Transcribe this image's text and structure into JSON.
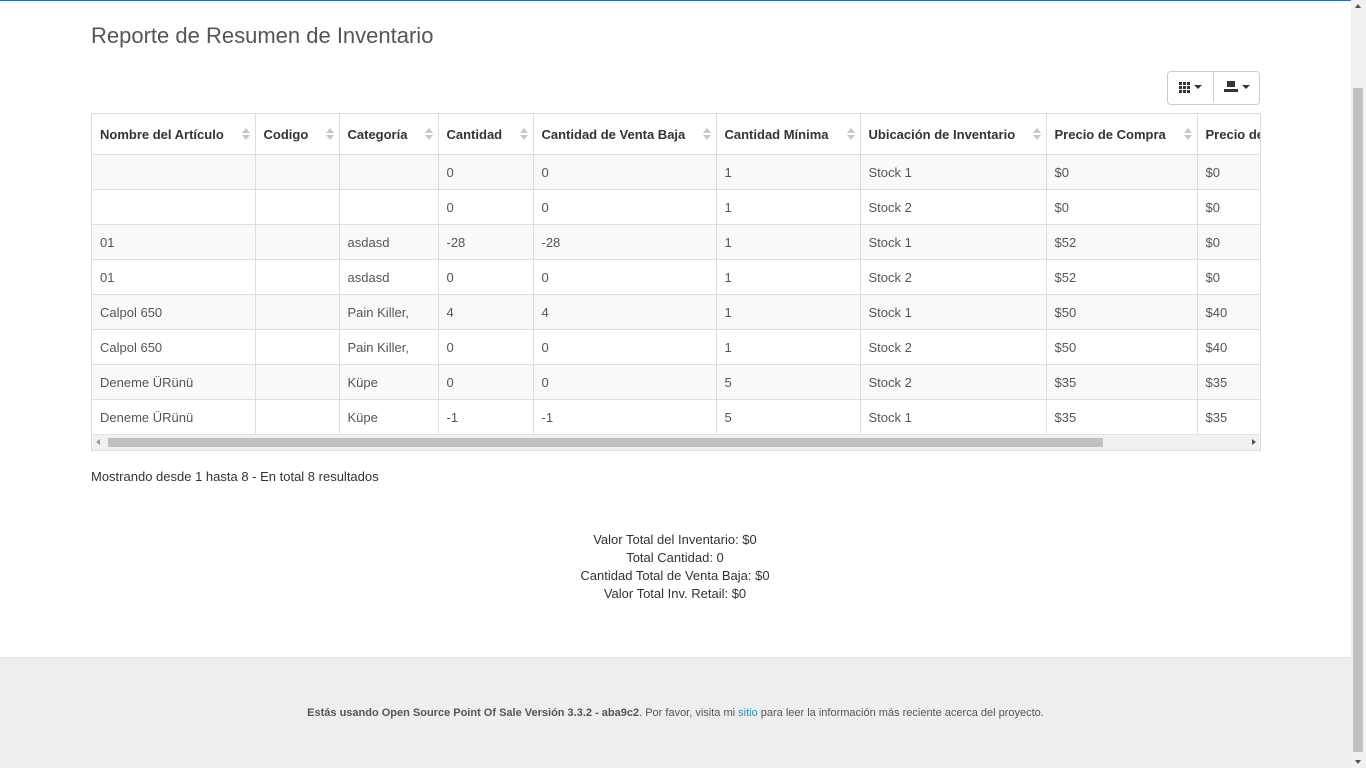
{
  "report": {
    "title": "Reporte de Resumen de Inventario"
  },
  "toolbar": {
    "columns_icon": "columns-grid-icon",
    "export_icon": "export-icon"
  },
  "table": {
    "headers": [
      "Nombre del Artículo",
      "Codigo",
      "Categoría",
      "Cantidad",
      "Cantidad de Venta Baja",
      "Cantidad Mínima",
      "Ubicación de Inventario",
      "Precio de Compra",
      "Precio de"
    ],
    "rows": [
      [
        "",
        "",
        "",
        "0",
        "0",
        "1",
        "Stock 1",
        "$0",
        "$0"
      ],
      [
        "",
        "",
        "",
        "0",
        "0",
        "1",
        "Stock 2",
        "$0",
        "$0"
      ],
      [
        "01",
        "",
        "asdasd",
        "-28",
        "-28",
        "1",
        "Stock 1",
        "$52",
        "$0"
      ],
      [
        "01",
        "",
        "asdasd",
        "0",
        "0",
        "1",
        "Stock 2",
        "$52",
        "$0"
      ],
      [
        "Calpol 650",
        "",
        "Pain Killer,",
        "4",
        "4",
        "1",
        "Stock 1",
        "$50",
        "$40"
      ],
      [
        "Calpol 650",
        "",
        "Pain Killer,",
        "0",
        "0",
        "1",
        "Stock 2",
        "$50",
        "$40"
      ],
      [
        "Deneme ÜRünü",
        "",
        "Küpe",
        "0",
        "0",
        "5",
        "Stock 2",
        "$35",
        "$35"
      ],
      [
        "Deneme ÜRünü",
        "",
        "Küpe",
        "-1",
        "-1",
        "5",
        "Stock 1",
        "$35",
        "$35"
      ]
    ]
  },
  "pagination": {
    "info": "Mostrando desde 1 hasta 8 - En total 8 resultados"
  },
  "summary": {
    "total_inventory_value": "Valor Total del Inventario: $0",
    "total_quantity": "Total Cantidad: 0",
    "total_low_sell_quantity": "Cantidad Total de Venta Baja: $0",
    "total_retail_value": "Valor Total Inv. Retail: $0"
  },
  "footer": {
    "version_text": "Estás usando Open Source Point Of Sale Versión 3.3.2 - aba9c2",
    "before_link": ". Por favor, visita mi ",
    "link_text": "sitio",
    "after_link": " para leer la información más reciente acerca del proyecto."
  },
  "colors": {
    "link": "#2a8fbd",
    "top_border": "#2a6db5",
    "footer_bg": "#eeeeee"
  }
}
